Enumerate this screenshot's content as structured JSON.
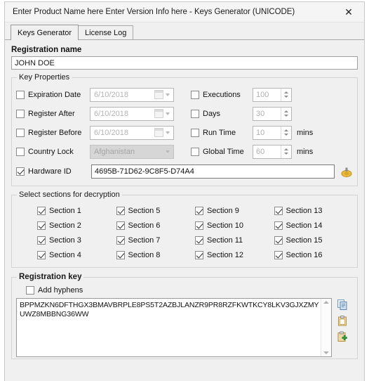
{
  "window": {
    "title": "Enter Product Name here Enter Version Info here - Keys Generator (UNICODE)",
    "close_label": "✕"
  },
  "tabs": [
    {
      "label": "Keys Generator",
      "selected": true
    },
    {
      "label": "License Log",
      "selected": false
    }
  ],
  "registration_name": {
    "label": "Registration name",
    "value": "JOHN DOE"
  },
  "key_properties": {
    "label": "Key Properties",
    "left_rows": [
      {
        "label": "Expiration Date",
        "checked": false,
        "value": "6/10/2018",
        "type": "date"
      },
      {
        "label": "Register After",
        "checked": false,
        "value": "6/10/2018",
        "type": "date"
      },
      {
        "label": "Register Before",
        "checked": false,
        "value": "6/10/2018",
        "type": "date"
      },
      {
        "label": "Country Lock",
        "checked": false,
        "value": "Afghanistan",
        "type": "combo"
      }
    ],
    "right_rows": [
      {
        "label": "Executions",
        "checked": false,
        "value": "100",
        "unit": ""
      },
      {
        "label": "Days",
        "checked": false,
        "value": "30",
        "unit": ""
      },
      {
        "label": "Run Time",
        "checked": false,
        "value": "10",
        "unit": "mins"
      },
      {
        "label": "Global Time",
        "checked": false,
        "value": "60",
        "unit": "mins"
      }
    ],
    "hardware_id": {
      "label": "Hardware ID",
      "checked": true,
      "value": "4695B-71D62-9C8F5-D74A4"
    }
  },
  "sections": {
    "label": "Select sections for decryption",
    "items": [
      {
        "label": "Section 1",
        "checked": true
      },
      {
        "label": "Section 2",
        "checked": true
      },
      {
        "label": "Section 3",
        "checked": true
      },
      {
        "label": "Section 4",
        "checked": true
      },
      {
        "label": "Section 5",
        "checked": true
      },
      {
        "label": "Section 6",
        "checked": true
      },
      {
        "label": "Section 7",
        "checked": true
      },
      {
        "label": "Section 8",
        "checked": true
      },
      {
        "label": "Section 9",
        "checked": true
      },
      {
        "label": "Section 10",
        "checked": true
      },
      {
        "label": "Section 11",
        "checked": true
      },
      {
        "label": "Section 12",
        "checked": true
      },
      {
        "label": "Section 13",
        "checked": true
      },
      {
        "label": "Section 14",
        "checked": true
      },
      {
        "label": "Section 15",
        "checked": true
      },
      {
        "label": "Section 16",
        "checked": true
      }
    ]
  },
  "registration_key": {
    "label": "Registration key",
    "add_hyphens_label": "Add hyphens",
    "add_hyphens_checked": false,
    "value": "BPPMZKN6DFTHGX3BMAVBRPLE8PS5T2AZBJLANZR9PR8RZFKWTKCY8LKV3GJXZMYUWZ8MBBNG36WW",
    "tools": [
      {
        "name": "copy-icon"
      },
      {
        "name": "paste-icon"
      },
      {
        "name": "add-to-clipboard-icon"
      }
    ]
  },
  "colors": {
    "window_bg": "#f0f0f0",
    "field_bg": "#ffffff",
    "disabled_bg": "#d6d6d6",
    "placeholder_text": "#b4b4b4",
    "accent_gold": "#e8b33a",
    "accent_green": "#3aa03a",
    "accent_blue": "#7ea6c8"
  }
}
